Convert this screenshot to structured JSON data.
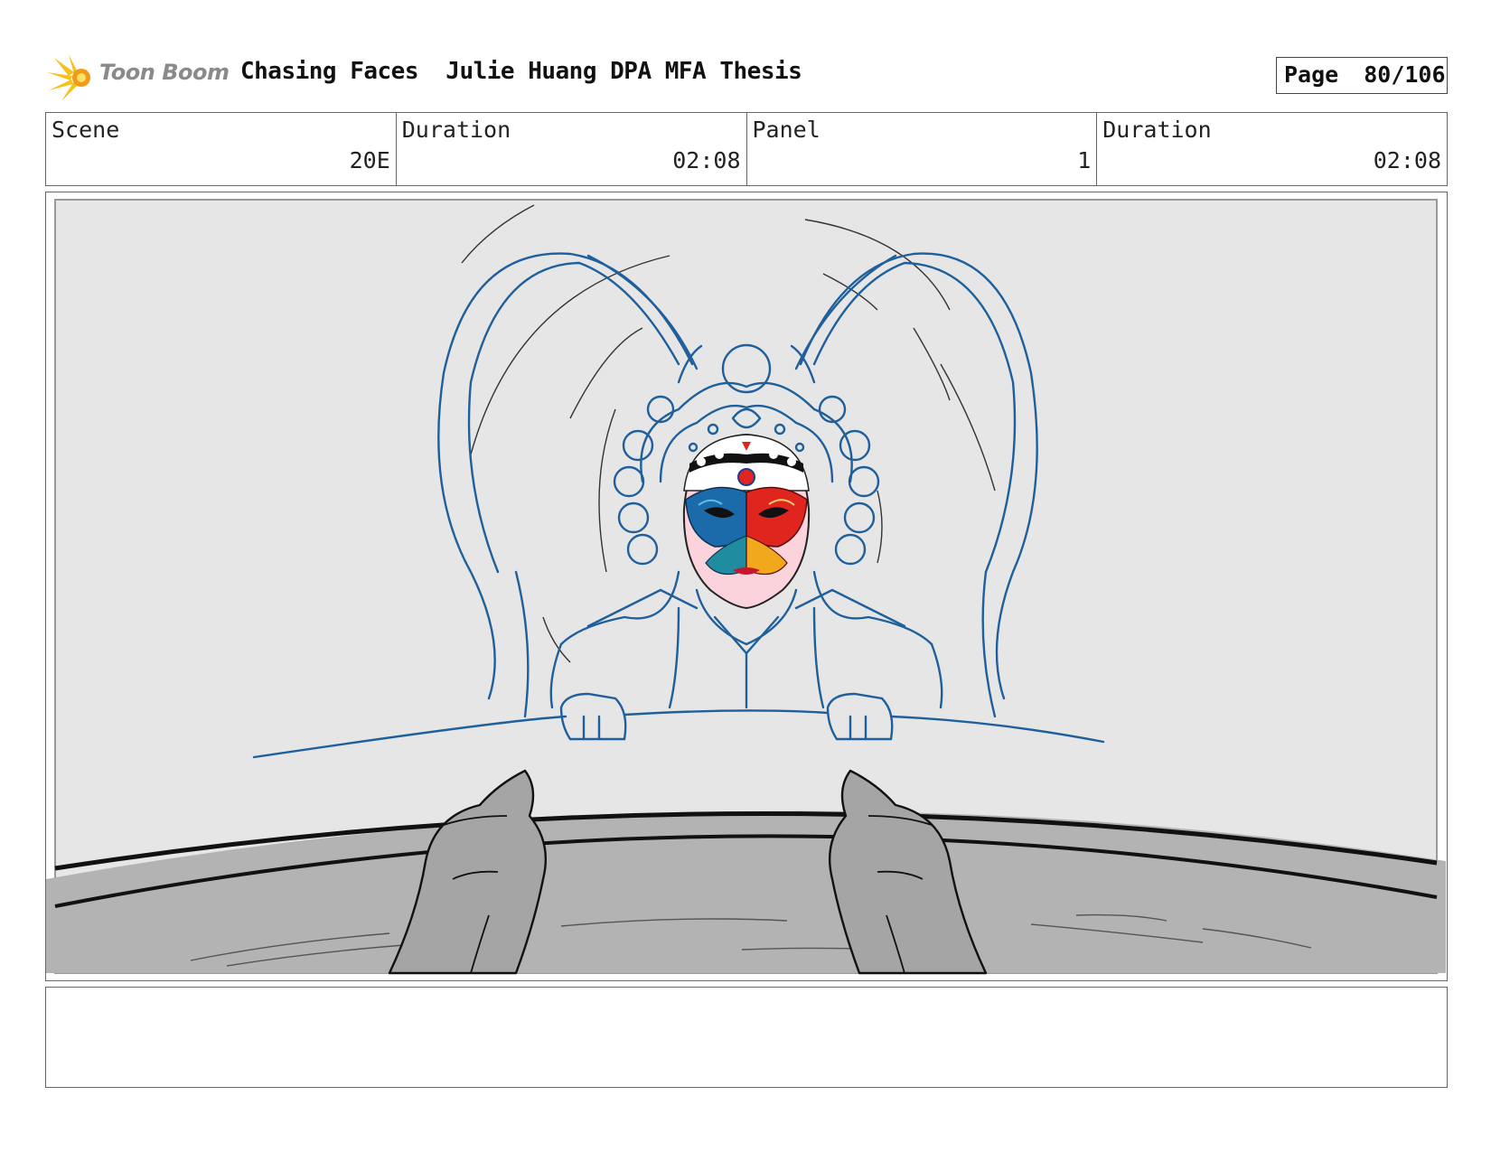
{
  "header": {
    "logo_text": "Toon Boom",
    "title": "Chasing Faces  Julie Huang DPA MFA Thesis",
    "page_label": "Page",
    "page_value": "80/106"
  },
  "info": {
    "scene_label": "Scene",
    "scene_value": "20E",
    "duration_label": "Duration",
    "duration_value": "02:08",
    "panel_label": "Panel",
    "panel_value": "1",
    "panel_duration_label": "Duration",
    "panel_duration_value": "02:08"
  },
  "notes": {
    "text": ""
  },
  "colors": {
    "sketch_blue": "#1f5f9c",
    "mask_red": "#e0251f",
    "mask_blue": "#1b6bab",
    "panel_bg": "#e6e6e6",
    "foreground_gray": "#b3b3b3"
  }
}
